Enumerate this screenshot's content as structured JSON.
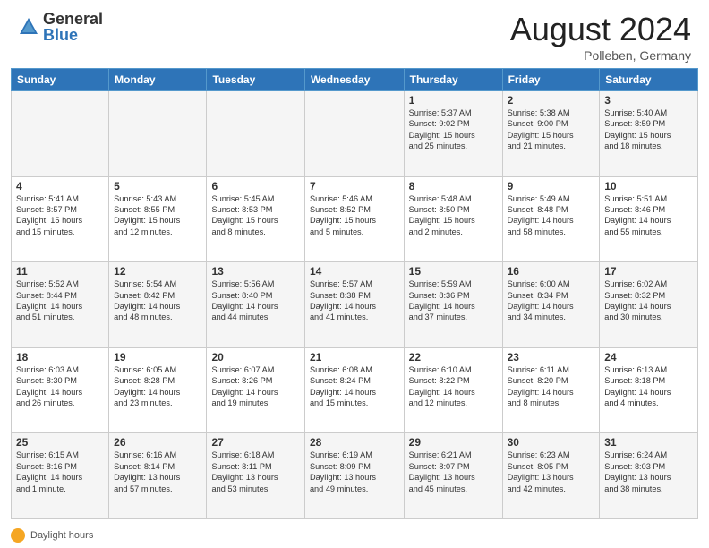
{
  "header": {
    "logo_general": "General",
    "logo_blue": "Blue",
    "month_title": "August 2024",
    "location": "Polleben, Germany"
  },
  "footer": {
    "label": "Daylight hours"
  },
  "days_of_week": [
    "Sunday",
    "Monday",
    "Tuesday",
    "Wednesday",
    "Thursday",
    "Friday",
    "Saturday"
  ],
  "weeks": [
    [
      {
        "num": "",
        "info": ""
      },
      {
        "num": "",
        "info": ""
      },
      {
        "num": "",
        "info": ""
      },
      {
        "num": "",
        "info": ""
      },
      {
        "num": "1",
        "info": "Sunrise: 5:37 AM\nSunset: 9:02 PM\nDaylight: 15 hours\nand 25 minutes."
      },
      {
        "num": "2",
        "info": "Sunrise: 5:38 AM\nSunset: 9:00 PM\nDaylight: 15 hours\nand 21 minutes."
      },
      {
        "num": "3",
        "info": "Sunrise: 5:40 AM\nSunset: 8:59 PM\nDaylight: 15 hours\nand 18 minutes."
      }
    ],
    [
      {
        "num": "4",
        "info": "Sunrise: 5:41 AM\nSunset: 8:57 PM\nDaylight: 15 hours\nand 15 minutes."
      },
      {
        "num": "5",
        "info": "Sunrise: 5:43 AM\nSunset: 8:55 PM\nDaylight: 15 hours\nand 12 minutes."
      },
      {
        "num": "6",
        "info": "Sunrise: 5:45 AM\nSunset: 8:53 PM\nDaylight: 15 hours\nand 8 minutes."
      },
      {
        "num": "7",
        "info": "Sunrise: 5:46 AM\nSunset: 8:52 PM\nDaylight: 15 hours\nand 5 minutes."
      },
      {
        "num": "8",
        "info": "Sunrise: 5:48 AM\nSunset: 8:50 PM\nDaylight: 15 hours\nand 2 minutes."
      },
      {
        "num": "9",
        "info": "Sunrise: 5:49 AM\nSunset: 8:48 PM\nDaylight: 14 hours\nand 58 minutes."
      },
      {
        "num": "10",
        "info": "Sunrise: 5:51 AM\nSunset: 8:46 PM\nDaylight: 14 hours\nand 55 minutes."
      }
    ],
    [
      {
        "num": "11",
        "info": "Sunrise: 5:52 AM\nSunset: 8:44 PM\nDaylight: 14 hours\nand 51 minutes."
      },
      {
        "num": "12",
        "info": "Sunrise: 5:54 AM\nSunset: 8:42 PM\nDaylight: 14 hours\nand 48 minutes."
      },
      {
        "num": "13",
        "info": "Sunrise: 5:56 AM\nSunset: 8:40 PM\nDaylight: 14 hours\nand 44 minutes."
      },
      {
        "num": "14",
        "info": "Sunrise: 5:57 AM\nSunset: 8:38 PM\nDaylight: 14 hours\nand 41 minutes."
      },
      {
        "num": "15",
        "info": "Sunrise: 5:59 AM\nSunset: 8:36 PM\nDaylight: 14 hours\nand 37 minutes."
      },
      {
        "num": "16",
        "info": "Sunrise: 6:00 AM\nSunset: 8:34 PM\nDaylight: 14 hours\nand 34 minutes."
      },
      {
        "num": "17",
        "info": "Sunrise: 6:02 AM\nSunset: 8:32 PM\nDaylight: 14 hours\nand 30 minutes."
      }
    ],
    [
      {
        "num": "18",
        "info": "Sunrise: 6:03 AM\nSunset: 8:30 PM\nDaylight: 14 hours\nand 26 minutes."
      },
      {
        "num": "19",
        "info": "Sunrise: 6:05 AM\nSunset: 8:28 PM\nDaylight: 14 hours\nand 23 minutes."
      },
      {
        "num": "20",
        "info": "Sunrise: 6:07 AM\nSunset: 8:26 PM\nDaylight: 14 hours\nand 19 minutes."
      },
      {
        "num": "21",
        "info": "Sunrise: 6:08 AM\nSunset: 8:24 PM\nDaylight: 14 hours\nand 15 minutes."
      },
      {
        "num": "22",
        "info": "Sunrise: 6:10 AM\nSunset: 8:22 PM\nDaylight: 14 hours\nand 12 minutes."
      },
      {
        "num": "23",
        "info": "Sunrise: 6:11 AM\nSunset: 8:20 PM\nDaylight: 14 hours\nand 8 minutes."
      },
      {
        "num": "24",
        "info": "Sunrise: 6:13 AM\nSunset: 8:18 PM\nDaylight: 14 hours\nand 4 minutes."
      }
    ],
    [
      {
        "num": "25",
        "info": "Sunrise: 6:15 AM\nSunset: 8:16 PM\nDaylight: 14 hours\nand 1 minute."
      },
      {
        "num": "26",
        "info": "Sunrise: 6:16 AM\nSunset: 8:14 PM\nDaylight: 13 hours\nand 57 minutes."
      },
      {
        "num": "27",
        "info": "Sunrise: 6:18 AM\nSunset: 8:11 PM\nDaylight: 13 hours\nand 53 minutes."
      },
      {
        "num": "28",
        "info": "Sunrise: 6:19 AM\nSunset: 8:09 PM\nDaylight: 13 hours\nand 49 minutes."
      },
      {
        "num": "29",
        "info": "Sunrise: 6:21 AM\nSunset: 8:07 PM\nDaylight: 13 hours\nand 45 minutes."
      },
      {
        "num": "30",
        "info": "Sunrise: 6:23 AM\nSunset: 8:05 PM\nDaylight: 13 hours\nand 42 minutes."
      },
      {
        "num": "31",
        "info": "Sunrise: 6:24 AM\nSunset: 8:03 PM\nDaylight: 13 hours\nand 38 minutes."
      }
    ]
  ]
}
